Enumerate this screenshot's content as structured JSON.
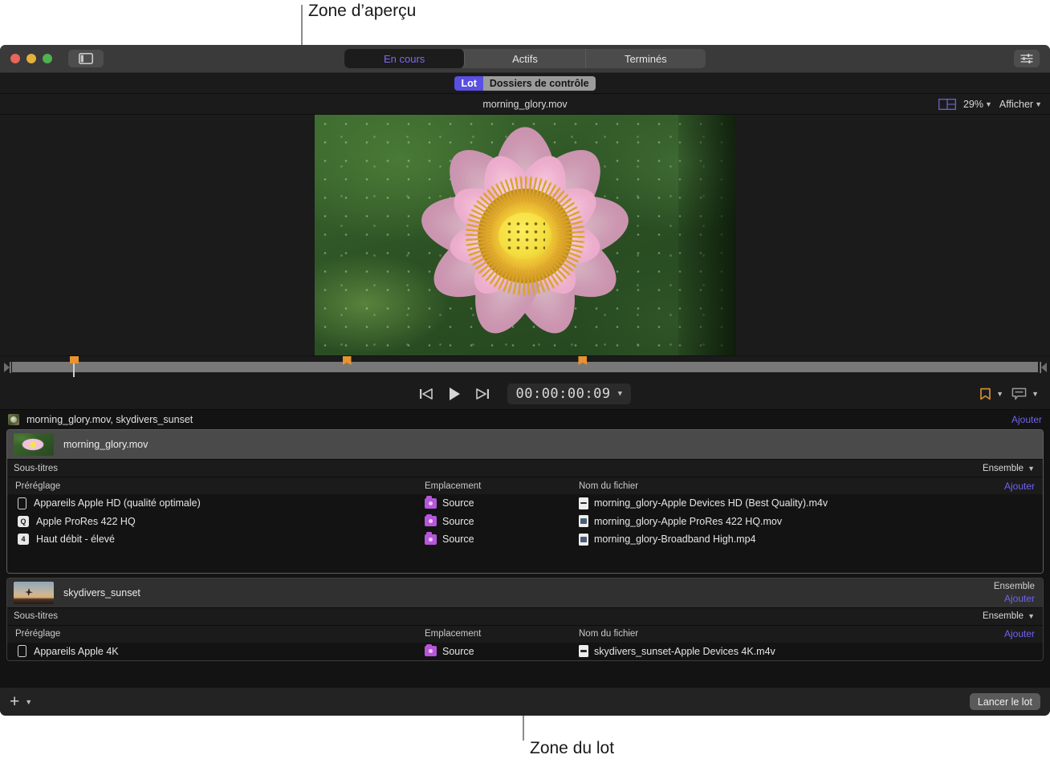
{
  "annotations": {
    "preview_zone": "Zone d’aperçu",
    "batch_zone": "Zone du lot"
  },
  "titlebar": {
    "sidebar_toggle": "sidebar-toggle",
    "inspector": "inspector-toggle",
    "tabs": [
      {
        "label": "En cours",
        "active": true
      },
      {
        "label": "Actifs",
        "active": false
      },
      {
        "label": "Terminés",
        "active": false
      }
    ]
  },
  "lotbar": {
    "segments": [
      {
        "label": "Lot",
        "active": true
      },
      {
        "label": "Dossiers de contrôle",
        "active": false
      }
    ]
  },
  "preview": {
    "title": "morning_glory.mov",
    "zoom": "29%",
    "view_menu": "Afficher"
  },
  "transport": {
    "timecode": "00:00:00:09",
    "prev_label": "go-to-start",
    "play_label": "play",
    "next_label": "go-to-end"
  },
  "batch": {
    "header_title": "morning_glory.mov, skydivers_sunset",
    "header_add": "Ajouter",
    "columns": {
      "preset": "Préréglage",
      "location": "Emplacement",
      "filename": "Nom du fichier",
      "add": "Ajouter"
    },
    "subtitles_label": "Sous-titres",
    "ensemble_label": "Ensemble",
    "jobs": [
      {
        "title": "morning_glory.mov",
        "thumb": "flower-thumbnail",
        "selected": true,
        "subtitles": "Sous-titres",
        "subtitles_value": "Ensemble",
        "outputs": [
          {
            "preset": "Appareils Apple HD (qualité optimale)",
            "preset_icon": "device-phone-icon",
            "location": "Source",
            "filename": "morning_glory-Apple Devices HD (Best Quality).m4v",
            "file_icon": "m4v-file-icon"
          },
          {
            "preset": "Apple ProRes 422 HQ",
            "preset_icon": "prores-badge-icon",
            "preset_badge": "Q",
            "location": "Source",
            "filename": "morning_glory-Apple ProRes 422 HQ.mov",
            "file_icon": "mov-file-icon"
          },
          {
            "preset": "Haut débit - élevé",
            "preset_icon": "mp4-badge-icon",
            "preset_badge": "4",
            "location": "Source",
            "filename": "morning_glory-Broadband High.mp4",
            "file_icon": "mp4-file-icon"
          }
        ]
      },
      {
        "title": "skydivers_sunset",
        "thumb": "skydivers-thumbnail",
        "selected": false,
        "title_right_label": "Ensemble",
        "title_right_add": "Ajouter",
        "subtitles": "Sous-titres",
        "subtitles_value": "Ensemble",
        "outputs": [
          {
            "preset": "Appareils Apple 4K",
            "preset_icon": "device-phone-icon",
            "location": "Source",
            "filename": "skydivers_sunset-Apple Devices 4K.m4v",
            "file_icon": "m4v-file-icon"
          }
        ]
      }
    ]
  },
  "bottom": {
    "add_label": "+",
    "launch_label": "Lancer le lot"
  },
  "colors": {
    "accent_purple": "#5a4fe0",
    "link_purple": "#6f63ef",
    "marker_orange": "#e8932f",
    "folder_purple": "#b557d8"
  }
}
